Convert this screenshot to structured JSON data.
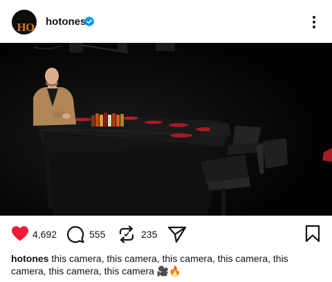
{
  "post": {
    "username": "hotones",
    "avatar_icon": "hot-ones-logo",
    "verified_icon": "verified-badge-icon",
    "more_icon": "more-options-icon"
  },
  "actions": {
    "likes": "4,692",
    "comments": "555",
    "reposts": "235",
    "like_icon": "heart-icon",
    "like_color": "#ed1c3a",
    "comment_icon": "comment-bubble-icon",
    "repost_icon": "repost-icon",
    "share_icon": "send-icon",
    "save_icon": "bookmark-icon"
  },
  "caption": {
    "username": "hotones",
    "text": "this camera, this camera, this camera, this camera, this camera, this camera, this camera",
    "emojis": "🎥🔥"
  }
}
